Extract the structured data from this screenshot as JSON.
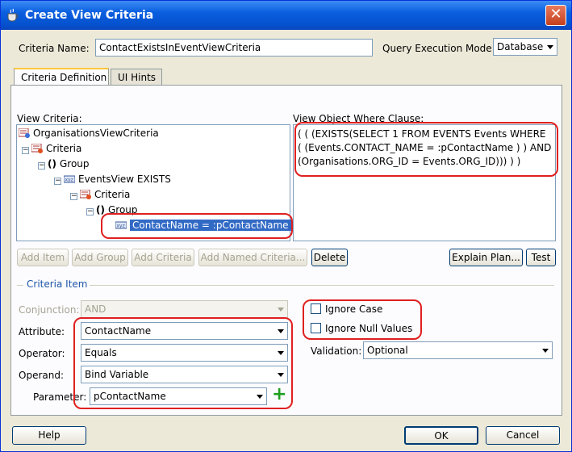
{
  "window": {
    "title": "Create View Criteria",
    "close_glyph": "✕"
  },
  "header": {
    "criteria_name_label": "Criteria Name:",
    "criteria_name_value": "ContactExistsInEventViewCriteria",
    "query_mode_label": "Query Execution Mode:",
    "query_mode_value": "Database"
  },
  "tabs": [
    {
      "label": "Criteria Definition",
      "active": true
    },
    {
      "label": "UI Hints",
      "active": false
    }
  ],
  "view_criteria": {
    "label": "View Criteria:",
    "tree": [
      {
        "label": "OrganisationsViewCriteria",
        "icon": "view-criteria-icon",
        "level": 0
      },
      {
        "label": "Criteria",
        "icon": "criteria-icon",
        "level": 1
      },
      {
        "label": "Group",
        "icon": "group-parens-icon",
        "level": 2
      },
      {
        "label": "EventsView EXISTS",
        "icon": "view-object-icon",
        "level": 3
      },
      {
        "label": "Criteria",
        "icon": "criteria-icon",
        "level": 4
      },
      {
        "label": "Group",
        "icon": "group-parens-icon",
        "level": 5
      },
      {
        "label": "ContactName = :pContactName",
        "icon": "criteria-item-icon",
        "level": 6,
        "selected": true
      }
    ]
  },
  "where_clause": {
    "label": "View Object Where Clause:",
    "lines": [
      "( ( (EXISTS(SELECT 1 FROM EVENTS Events WHERE",
      "( (Events.CONTACT_NAME = :pContactName ) )  AND",
      "(Organisations.ORG_ID = Events.ORG_ID))) ) )"
    ]
  },
  "tree_buttons": {
    "add_item": "Add Item",
    "add_group": "Add Group",
    "add_criteria": "Add Criteria",
    "add_named_criteria": "Add Named Criteria...",
    "delete": "Delete",
    "explain_plan": "Explain Plan...",
    "test": "Test"
  },
  "criteria_item": {
    "section_label": "Criteria Item",
    "conjunction_label": "Conjunction:",
    "conjunction_value": "AND",
    "attribute_label": "Attribute:",
    "attribute_value": "ContactName",
    "operator_label": "Operator:",
    "operator_value": "Equals",
    "operand_label": "Operand:",
    "operand_value": "Bind Variable",
    "parameter_label": "Parameter:",
    "parameter_value": "pContactName",
    "add_parameter_glyph": "+",
    "ignore_case_label": "Ignore Case",
    "ignore_null_label": "Ignore Null Values",
    "validation_label": "Validation:",
    "validation_value": "Optional"
  },
  "footer": {
    "help": "Help",
    "ok": "OK",
    "cancel": "Cancel"
  }
}
